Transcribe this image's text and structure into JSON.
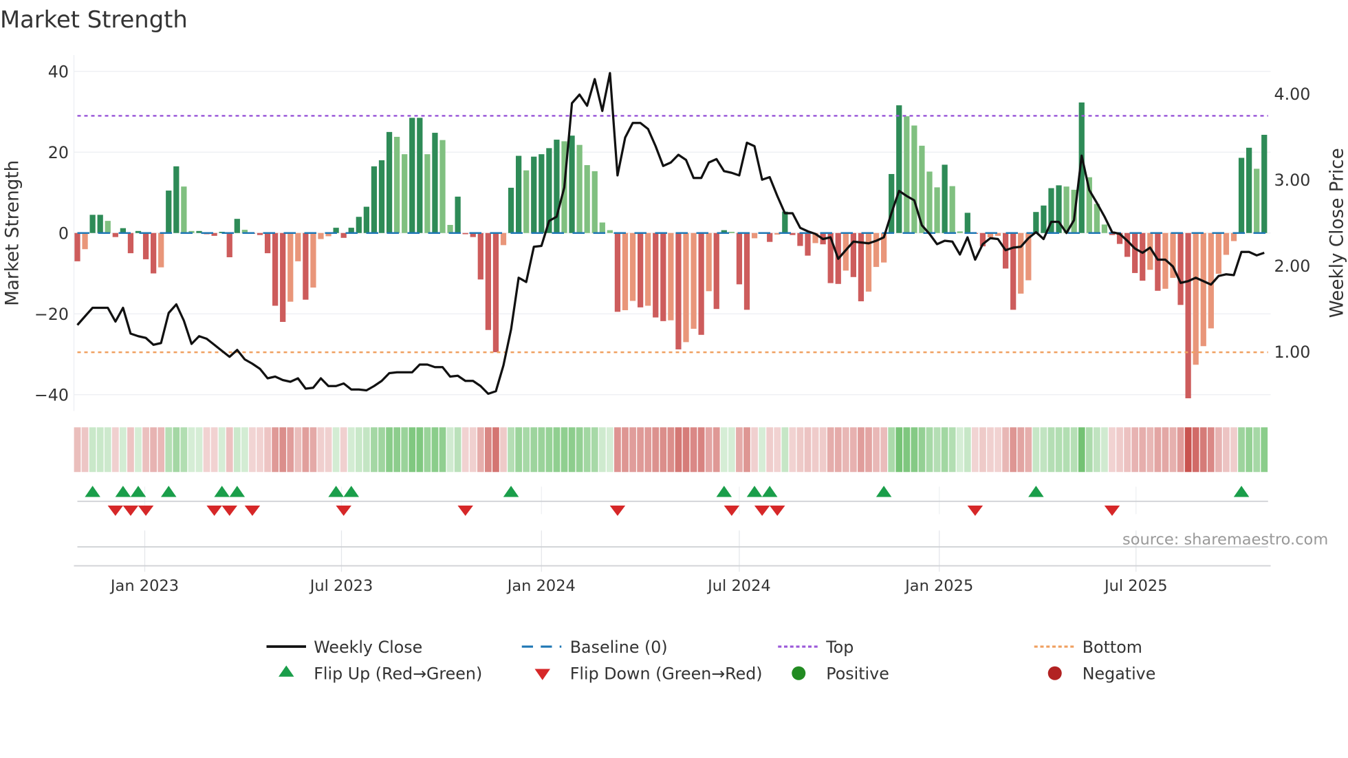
{
  "chart_data": {
    "type": "bar",
    "title": "Market Strength",
    "ylabel": "Market Strength",
    "y2label": "Weekly Close Price",
    "ylim": [
      -44,
      44
    ],
    "yticks": [
      40,
      20,
      0,
      -20,
      -40
    ],
    "ytick_labels": [
      "40",
      "20",
      "0",
      "−20",
      "−40"
    ],
    "y2ticks": [
      4,
      3,
      2,
      1
    ],
    "y2tick_labels": [
      "4.00",
      "3.00",
      "2.00",
      "1.00"
    ],
    "x_start": "2022-10-31",
    "frequency": "weekly",
    "xticks": [
      "2023-01-01",
      "2023-07-01",
      "2024-01-01",
      "2024-07-01",
      "2025-01-01",
      "2025-07-01"
    ],
    "xtick_labels": [
      "Jan 2023",
      "Jul 2023",
      "Jan 2024",
      "Jul 2024",
      "Jan 2025",
      "Jul 2025"
    ],
    "top_level": 29,
    "bottom_level": -29.5,
    "baseline": 0,
    "strength": [
      -7,
      -4,
      4.5,
      4.5,
      3,
      -1,
      1.2,
      -5,
      0.5,
      -6.5,
      -10,
      -8.5,
      10.5,
      16.5,
      11.5,
      0.5,
      0.5,
      -0.3,
      -0.7,
      0.3,
      -6,
      3.5,
      0.8,
      -0.2,
      -0.5,
      -5,
      -18,
      -22,
      -17,
      -7,
      -16.5,
      -13.5,
      -1.5,
      -0.8,
      1.3,
      -1.2,
      1.3,
      4,
      6.5,
      16.5,
      18,
      25,
      23.8,
      19.5,
      28.5,
      28.5,
      19.5,
      24.8,
      23,
      2,
      9,
      -0.3,
      -1,
      -11.5,
      -24,
      -29.5,
      -3,
      11.2,
      19.1,
      15.5,
      18.9,
      19.5,
      21,
      23.1,
      22.7,
      24.1,
      21.8,
      16.8,
      15.3,
      2.6,
      0.7,
      -19.5,
      -19.1,
      -16.8,
      -18.4,
      -18,
      -20.9,
      -21.8,
      -21.6,
      -28.8,
      -27,
      -23.7,
      -25.2,
      -14.4,
      -18.8,
      0.7,
      0.3,
      -12.7,
      -19,
      -1.3,
      0.2,
      -2.2,
      -0.4,
      5.3,
      -0.5,
      -3.2,
      -5.6,
      -2.5,
      -2.8,
      -12.4,
      -12.6,
      -9.3,
      -10.9,
      -16.9,
      -14.5,
      -8.4,
      -7.3,
      14.6,
      31.6,
      28.9,
      26.6,
      21.6,
      15.2,
      11.3,
      16.9,
      11.6,
      0.4,
      5,
      -0.2,
      -3.3,
      -1.1,
      -0.7,
      -8.8,
      -19,
      -15,
      -11.7,
      5.2,
      6.8,
      11.1,
      11.8,
      11.5,
      10.7,
      32.3,
      13.8,
      7.2,
      2.1,
      -0.5,
      -2.7,
      -5.9,
      -9.9,
      -11.8,
      -9.1,
      -14.3,
      -13.8,
      -11.1,
      -17.8,
      -40.9,
      -32.6,
      -28,
      -23.6,
      -10.1,
      -5.4,
      -2,
      18.6,
      21.1,
      15.9,
      24.3
    ],
    "weekly_close": [
      1.31,
      1.41,
      1.51,
      1.51,
      1.51,
      1.35,
      1.51,
      1.21,
      1.18,
      1.16,
      1.08,
      1.1,
      1.45,
      1.55,
      1.36,
      1.09,
      1.18,
      1.15,
      1.08,
      1.01,
      0.94,
      1.02,
      0.91,
      0.86,
      0.8,
      0.69,
      0.71,
      0.67,
      0.65,
      0.69,
      0.57,
      0.58,
      0.69,
      0.6,
      0.6,
      0.63,
      0.56,
      0.56,
      0.55,
      0.6,
      0.66,
      0.75,
      0.76,
      0.76,
      0.76,
      0.85,
      0.85,
      0.82,
      0.82,
      0.71,
      0.72,
      0.66,
      0.66,
      0.6,
      0.51,
      0.54,
      0.84,
      1.26,
      1.86,
      1.81,
      2.22,
      2.23,
      2.52,
      2.57,
      2.91,
      3.89,
      3.99,
      3.86,
      4.17,
      3.8,
      4.24,
      3.05,
      3.49,
      3.66,
      3.66,
      3.59,
      3.39,
      3.16,
      3.2,
      3.29,
      3.23,
      3.02,
      3.02,
      3.2,
      3.24,
      3.1,
      3.08,
      3.05,
      3.43,
      3.39,
      3.0,
      3.03,
      2.81,
      2.61,
      2.61,
      2.44,
      2.4,
      2.37,
      2.31,
      2.33,
      2.08,
      2.18,
      2.28,
      2.27,
      2.26,
      2.29,
      2.33,
      2.61,
      2.87,
      2.81,
      2.76,
      2.47,
      2.37,
      2.25,
      2.29,
      2.28,
      2.13,
      2.33,
      2.07,
      2.25,
      2.32,
      2.31,
      2.18,
      2.21,
      2.22,
      2.32,
      2.39,
      2.31,
      2.51,
      2.51,
      2.38,
      2.53,
      3.28,
      2.88,
      2.73,
      2.57,
      2.39,
      2.37,
      2.29,
      2.2,
      2.15,
      2.21,
      2.07,
      2.07,
      1.99,
      1.8,
      1.82,
      1.86,
      1.82,
      1.78,
      1.88,
      1.9,
      1.89,
      2.16,
      2.16,
      2.12,
      2.15
    ],
    "flip_up_weeks": [
      2,
      6,
      8,
      12,
      19,
      21,
      34,
      36,
      57,
      85,
      89,
      91,
      106,
      126,
      153
    ],
    "flip_down_weeks": [
      5,
      7,
      9,
      18,
      20,
      23,
      35,
      51,
      71,
      86,
      90,
      92,
      118,
      136
    ],
    "legend": {
      "weekly_close": "Weekly Close",
      "baseline": "Baseline (0)",
      "top": "Top",
      "bottom": "Bottom",
      "flip_up": "Flip Up (Red→Green)",
      "flip_down": "Flip Down (Green→Red)",
      "positive": "Positive",
      "negative": "Negative",
      "placement": "bottom"
    },
    "source": "source: sharemaestro.com",
    "colors": {
      "pos_strong": "#2e8b57",
      "pos_weak": "#80c080",
      "neg_strong": "#cd5c5c",
      "neg_weak": "#e9967a",
      "baseline": "#1f77b4",
      "top": "#9b59d9",
      "bottom": "#f0a060",
      "flip_up": "#1a9e4a",
      "flip_down": "#d62728",
      "positive": "#228b22",
      "negative": "#b22222",
      "line": "#111111"
    }
  }
}
